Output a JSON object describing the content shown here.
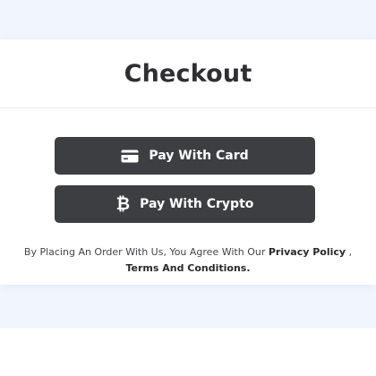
{
  "page": {
    "title": "Checkout"
  },
  "buttons": {
    "card": {
      "label": "Pay With Card",
      "icon": "credit-card-icon"
    },
    "crypto": {
      "label": "Pay With Crypto",
      "icon": "bitcoin-icon",
      "glyph": "₿"
    }
  },
  "terms": {
    "prefix": "By Placing An Order With Us, You Agree With Our ",
    "privacy_link": "Privacy Policy",
    "separator": " , ",
    "terms_link": "Terms And Conditions."
  },
  "colors": {
    "page_background": "#f1f6fe",
    "card_background": "#ffffff",
    "button_background": "#3d3e42",
    "button_text": "#ffffff",
    "title_text": "#2f2f33"
  }
}
